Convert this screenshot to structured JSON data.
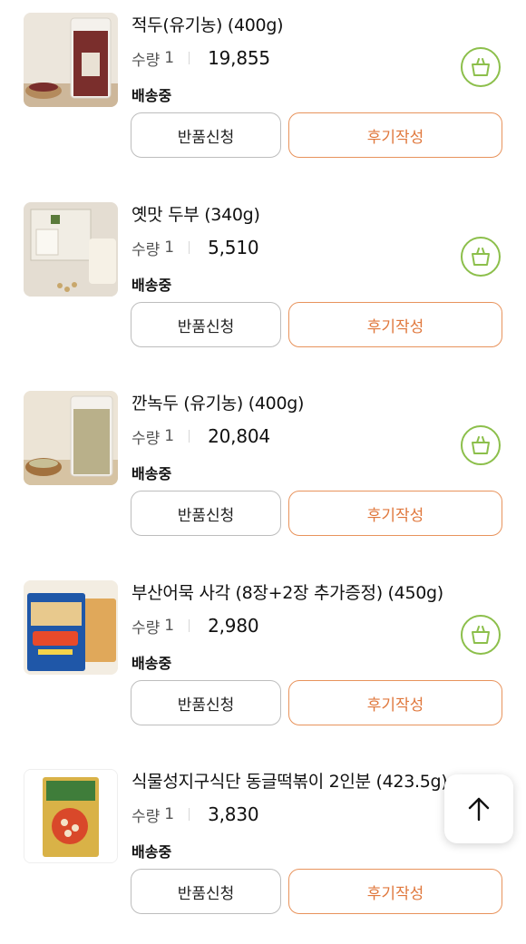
{
  "labels": {
    "quantity": "수량",
    "return_button": "반품신청",
    "review_button": "후기작성"
  },
  "colors": {
    "accent_green": "#8cbf4b",
    "accent_orange": "#e0783d"
  },
  "icons": {
    "cart": "shopping-basket-icon",
    "scroll_top": "arrow-up-icon"
  },
  "orders": [
    {
      "name": "적두(유기농) (400g)",
      "quantity": "1",
      "price": "19,855",
      "status": "배송중"
    },
    {
      "name": "옛맛 두부 (340g)",
      "quantity": "1",
      "price": "5,510",
      "status": "배송중"
    },
    {
      "name": "깐녹두 (유기농) (400g)",
      "quantity": "1",
      "price": "20,804",
      "status": "배송중"
    },
    {
      "name": "부산어묵 사각 (8장+2장 추가증정) (450g)",
      "quantity": "1",
      "price": "2,980",
      "status": "배송중"
    },
    {
      "name": "식물성지구식단 동글떡볶이 2인분 (423.5g)",
      "quantity": "1",
      "price": "3,830",
      "status": "배송중"
    }
  ]
}
